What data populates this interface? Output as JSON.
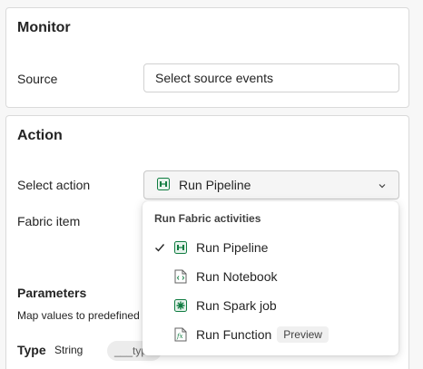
{
  "monitor": {
    "title": "Monitor",
    "source_label": "Source",
    "source_value": "Select source events"
  },
  "action": {
    "title": "Action",
    "select_action_label": "Select action",
    "select_action_value": "Run Pipeline",
    "fabric_item_label": "Fabric item",
    "parameters_title": "Parameters",
    "parameters_desc": "Map values to predefined",
    "type_label": "Type",
    "type_value": "String",
    "type_input_value": "___type"
  },
  "dropdown": {
    "heading": "Run Fabric activities",
    "items": [
      {
        "label": "Run Pipeline",
        "icon": "pipeline-icon",
        "selected": true
      },
      {
        "label": "Run Notebook",
        "icon": "notebook-icon",
        "selected": false
      },
      {
        "label": "Run Spark job",
        "icon": "spark-job-icon",
        "selected": false
      },
      {
        "label": "Run Function",
        "icon": "function-icon",
        "selected": false,
        "badge": "Preview"
      }
    ]
  },
  "colors": {
    "accent_green": "#107c41",
    "border": "#dadada",
    "background": "#f7f7f7"
  }
}
